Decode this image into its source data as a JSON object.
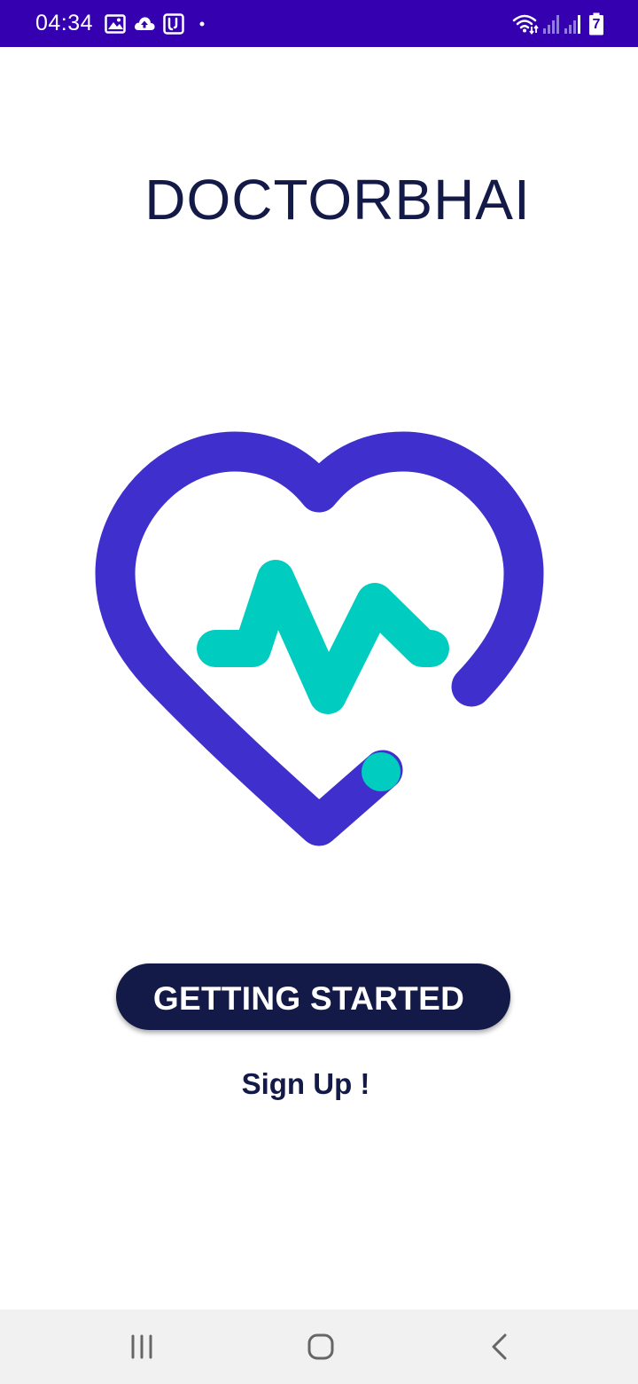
{
  "status_bar": {
    "time": "04:34",
    "battery_level": "7",
    "background_color": "#3500b0",
    "left_icons": [
      "image-icon",
      "cloud-upload-icon",
      "voicemail-icon",
      "dot-icon"
    ],
    "right_icons": [
      "wifi-icon",
      "signal-icon",
      "signal-icon",
      "battery-icon"
    ]
  },
  "app": {
    "title": "DOCTORBHAI",
    "logo_icon": "heart-pulse-icon",
    "primary_color": "#141a47",
    "heart_color": "#3f2fcd",
    "pulse_color": "#00ccc0"
  },
  "actions": {
    "getting_started_label": "GETTING STARTED",
    "sign_up_label": "Sign Up !"
  },
  "nav_bar": {
    "buttons": [
      "recent-apps-icon",
      "home-icon",
      "back-icon"
    ]
  }
}
